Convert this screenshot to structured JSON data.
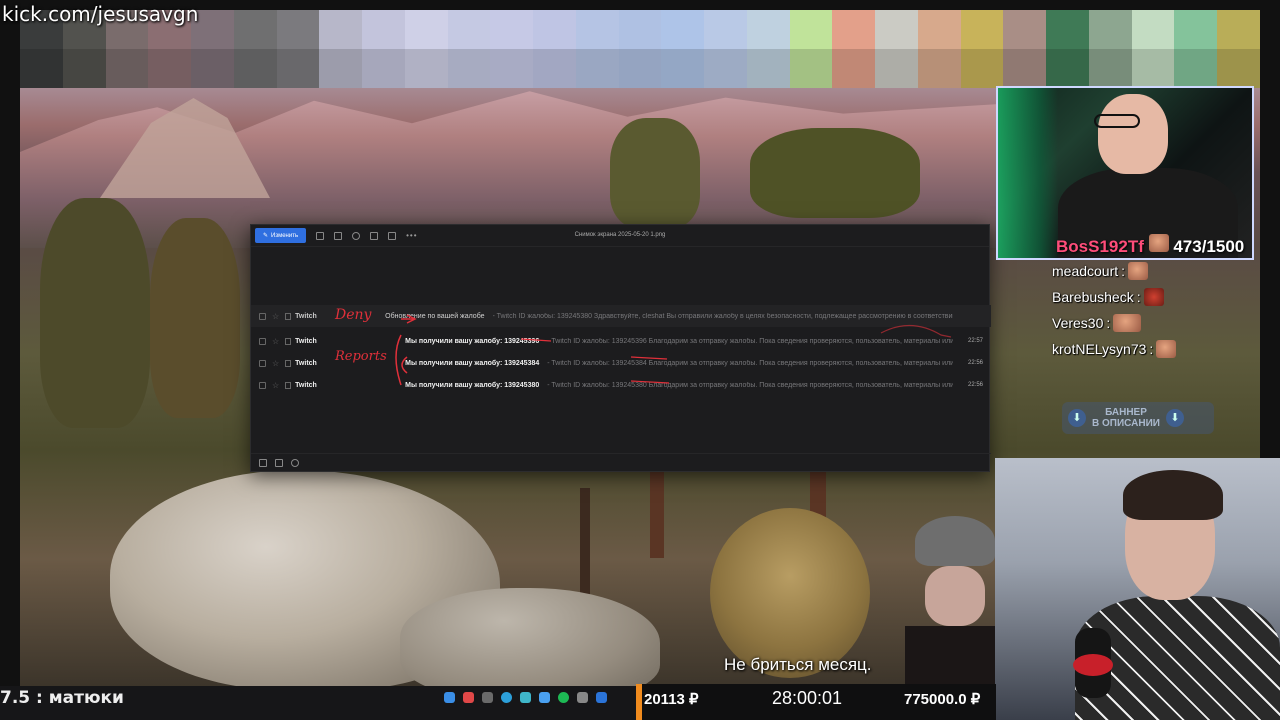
{
  "overlay": {
    "url": "kick.com/jesusavgn",
    "subtitle": "Не бриться месяц."
  },
  "mosaic_colors": [
    "#3a3c3c",
    "#52524e",
    "#7a6c6c",
    "#8b6e72",
    "#7e7078",
    "#6f6f70",
    "#7b7a7e",
    "#b7b7c9",
    "#c3c4dc",
    "#cfd0e7",
    "#c5c9e3",
    "#c6c9e6",
    "#bfc5e4",
    "#b5c4e4",
    "#afc1e3",
    "#aec4e8",
    "#b9c9e6",
    "#bfd1e0",
    "#c0e39a",
    "#e3a08a",
    "#cbcbc4",
    "#d7a98c",
    "#c8b35a",
    "#a98e86",
    "#3f7a56",
    "#8da690",
    "#c3dcc2",
    "#84c39b",
    "#b9ad58"
  ],
  "mail_client": {
    "toolbar": {
      "primary_label": "Изменить",
      "more_icon": "ellipsis-icon"
    },
    "title": "Снимок экрана 2025-05-20 1.png",
    "rows": [
      {
        "sender": "Twitch",
        "subject": "Обновление по вашей жалобе",
        "preview": "- Twitch ID жалобы: 139245380 Здравствуйте, cleshat Вы отправили жалобу в целях безопасности, подлежащее рассмотрению в соответствии",
        "date": ""
      },
      {
        "sender": "Twitch",
        "subject": "Мы получили вашу жалобу: 139245396",
        "preview": "- Twitch ID жалобы: 139245396 Благодарим за отправку жалобы. Пока сведения проверяются, пользователь, материалы или имя нарушения",
        "date": "22:57"
      },
      {
        "sender": "Twitch",
        "subject": "Мы получили вашу жалобу: 139245384",
        "preview": "- Twitch ID жалобы: 139245384 Благодарим за отправку жалобы. Пока сведения проверяются, пользователь, материалы или имени могут оставаться",
        "date": "22:56"
      },
      {
        "sender": "Twitch",
        "subject": "Мы получили вашу жалобу: 139245380",
        "preview": "- Twitch ID жалобы: 139245380 Благодарим за отправку жалобы. Пока сведения проверяются, пользователь, материалы или имени могут оставаться доступ...",
        "date": "22:56"
      }
    ],
    "annotations": {
      "deny": "Deny",
      "reports": "Reports"
    }
  },
  "streamer_cam": {
    "sub_name": "BosS192Tf",
    "sub_count": "473/1500"
  },
  "chat": [
    {
      "user": "meadcourt",
      "text": ":"
    },
    {
      "user": "Barebusheck",
      "text": ":"
    },
    {
      "user": "Veres30",
      "text": ":"
    },
    {
      "user": "krotNELysyn73",
      "text": ":"
    }
  ],
  "banner": {
    "line1": "БАННЕР",
    "line2": "В ОПИСАНИИ"
  },
  "bottom": {
    "ticker": "7.5 : матюки",
    "donation_total": "20113 ₽",
    "timer": "28:00:01",
    "goal": "775000.0 ₽"
  },
  "colors": {
    "accent": "#f08b1e",
    "annotation": "#e0303a",
    "mail_primary": "#2f6fe0"
  }
}
